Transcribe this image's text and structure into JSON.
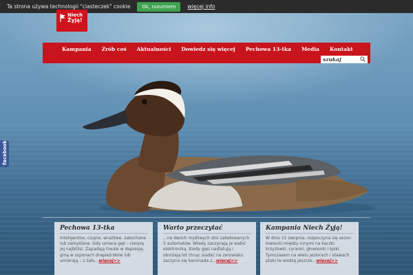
{
  "cookie_bar": {
    "text": "Ta strona używa technologii \"ciasteczek\" cookie",
    "ok_label": "Ok, rozumiem",
    "more_label": "więcej info"
  },
  "logo": {
    "line1": "Niech",
    "line2": "Żyją!"
  },
  "nav": {
    "items": [
      {
        "label": "Kampania"
      },
      {
        "label": "Zrób coś"
      },
      {
        "label": "Aktualności"
      },
      {
        "label": "Dowiedz się więcej"
      },
      {
        "label": "Pechowa 13-tka"
      },
      {
        "label": "Media"
      },
      {
        "label": "Kontakt"
      }
    ],
    "search_placeholder": "szukaj"
  },
  "facebook_tab": {
    "label": "facebook"
  },
  "cards": [
    {
      "title": "Pechowa 13-tka",
      "body": "Inteligentne, czujne, wrażliwe, zakochane lub zamyślone. Gdy umiera gęś – cierpią jej najbliżsi. Zapadają trwale w depresję, giną w szponach drapieżników lub umierają – z żalu...",
      "more": "więcej>>"
    },
    {
      "title": "Warto przeczytać",
      "body": "...na dwóch myśliwych stoi załadowanych 5 automatów. Wtedy zaczynają je wabić elektroniką. Kiedy gęsi nadlatują i obniżają lot chcąc siadać na zerowisku zaczyna się kanonada z...",
      "more": "więcej>>"
    },
    {
      "title": "Kampania Niech Żyją!",
      "body": "W dniu 15 sierpnia, rozpoczyna się sezon łowiecki między innymi na kaczki krzyżówki, cyranki, głowienki i łyski. Tymczasem na wielu jeziorach i stawach ptaki te wodzą jeszcze...",
      "more": "więcej>>"
    }
  ]
}
